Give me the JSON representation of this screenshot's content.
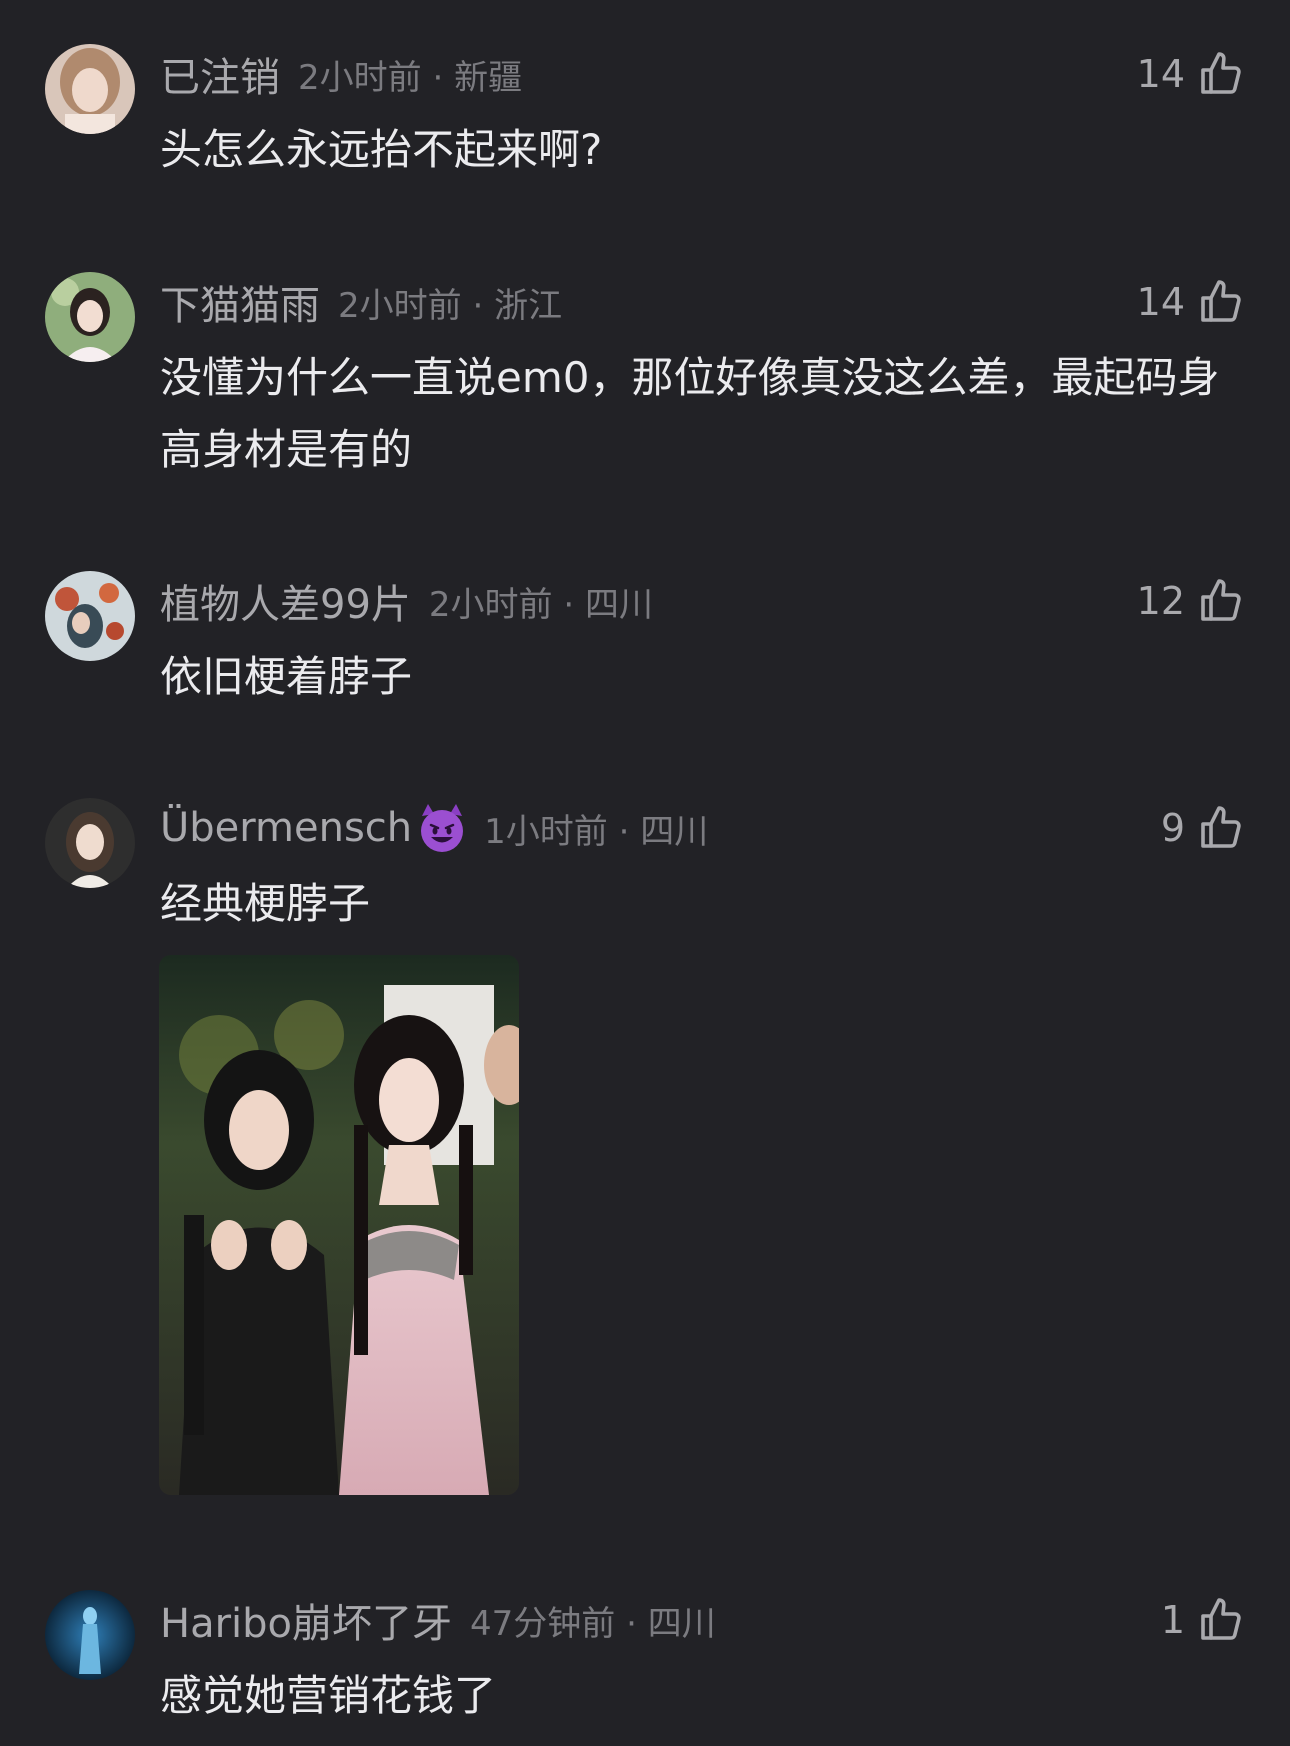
{
  "comments": [
    {
      "username": "已注销",
      "time": "2小时前",
      "location": "新疆",
      "likes": "14",
      "text": "头怎么永远抬不起来啊?",
      "avatar_color": "#d8c4b8"
    },
    {
      "username": "下猫猫雨",
      "time": "2小时前",
      "location": "浙江",
      "likes": "14",
      "text": "没懂为什么一直说em0，那位好像真没这么差，最起码身高身材是有的",
      "avatar_color": "#9cb88a"
    },
    {
      "username": "植物人差99片",
      "time": "2小时前",
      "location": "四川",
      "likes": "12",
      "text": "依旧梗着脖子",
      "avatar_color": "#6b8fa3"
    },
    {
      "username": "Übermensch",
      "badge_icon": "smiling-devil-emoji",
      "time": "1小时前",
      "location": "四川",
      "likes": "9",
      "text": "经典梗脖子",
      "avatar_color": "#3a3a3a"
    },
    {
      "username": "Haribo崩坏了牙",
      "time": "47分钟前",
      "location": "四川",
      "likes": "1",
      "text": "感觉她营销花钱了",
      "avatar_color": "#123a5c"
    }
  ],
  "meta_separator": " · ",
  "icons": {
    "like": "thumbs-up-icon"
  },
  "colors": {
    "background": "#222226",
    "username": "#a9a9ad",
    "meta": "#7b7b80",
    "text": "#ebebee",
    "badge": "#9b4fd1"
  }
}
